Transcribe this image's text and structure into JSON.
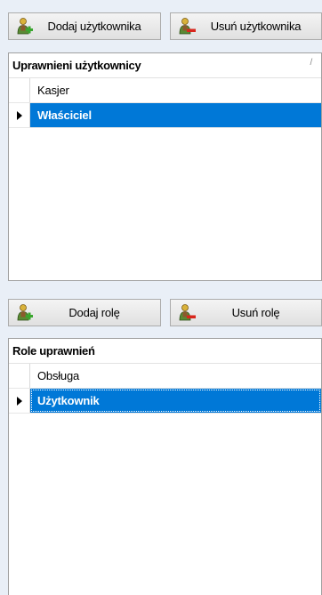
{
  "users": {
    "add_button": "Dodaj użytkownika",
    "remove_button": "Usuń użytkownika",
    "grid": {
      "header": "Uprawnieni użytkownicy",
      "rows": [
        {
          "label": "Kasjer",
          "selected": false
        },
        {
          "label": "Właściciel",
          "selected": true
        }
      ]
    }
  },
  "roles": {
    "add_button": "Dodaj rolę",
    "remove_button": "Usuń rolę",
    "grid": {
      "header": "Role uprawnień",
      "rows": [
        {
          "label": "Obsługa",
          "selected": false
        },
        {
          "label": "Użytkownik",
          "selected": true
        }
      ]
    }
  },
  "icons": {
    "add": "user-add-icon",
    "remove": "user-remove-icon"
  },
  "colors": {
    "selection": "#0078d7",
    "background": "#e9eff7"
  }
}
